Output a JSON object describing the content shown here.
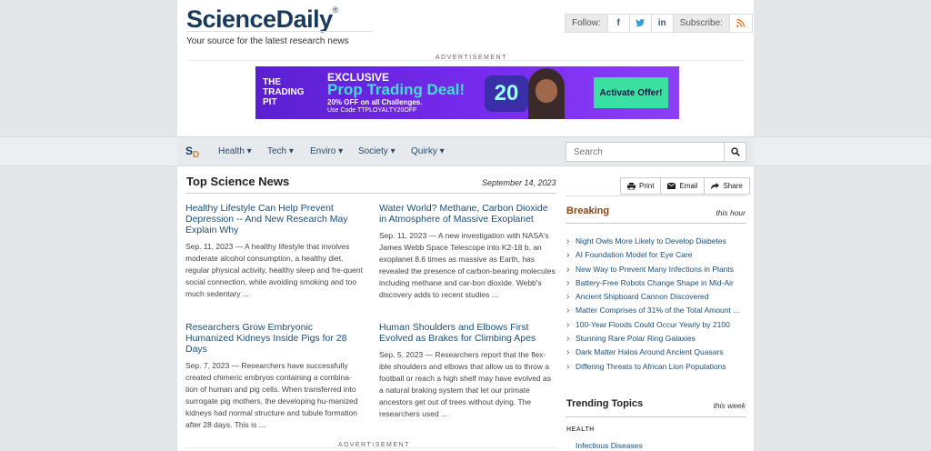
{
  "header": {
    "logo": "ScienceDaily",
    "logo_mark": "®",
    "tagline": "Your source for the latest research news",
    "follow_label": "Follow:",
    "subscribe_label": "Subscribe:"
  },
  "ads": {
    "label": "ADVERTISEMENT",
    "banner": {
      "brand": "THE TRADING PIT",
      "headline1": "EXCLUSIVE",
      "headline2": "Prop Trading Deal!",
      "offer": "20% OFF on all Challenges.",
      "code": "Use Code TTPLOYALTY20OFF",
      "graphic": "20",
      "cta": "Activate Offer!"
    }
  },
  "nav": {
    "logo_s": "S",
    "logo_d": "D",
    "items": [
      "Health ▾",
      "Tech ▾",
      "Enviro ▾",
      "Society ▾",
      "Quirky ▾"
    ],
    "search_placeholder": "Search"
  },
  "top_news": {
    "title": "Top Science News",
    "date": "September 14, 2023",
    "stories": [
      {
        "headline": "Healthy Lifestyle Can Help Prevent Depression -- And New Research May Explain Why",
        "summary": "Sep. 11, 2023 — A healthy lifestyle that involves moderate alcohol consumption, a healthy diet, regular physical activity, healthy sleep and fre-quent social connection, while avoiding smoking and too much sedentary ..."
      },
      {
        "headline": "Water World? Methane, Carbon Dioxide in Atmosphere of Massive Exoplanet",
        "summary": "Sep. 11, 2023 — A new investigation with NASA's James Webb Space Telescope into K2-18 b, an exoplanet 8.6 times as massive as Earth, has revealed the presence of carbon-bearing molecules including methane and car-bon dioxide. Webb's discovery adds to recent studies ..."
      },
      {
        "headline": "Researchers Grow Embryonic Humanized Kidneys Inside Pigs for 28 Days",
        "summary": "Sep. 7, 2023 — Researchers have successfully created chimeric embryos containing a combina-tion of human and pig cells. When transferred into surrogate pig mothers, the developing hu-manized kidneys had normal structure and tubule formation after 28 days. This is ..."
      },
      {
        "headline": "Human Shoulders and Elbows First Evolved as Brakes for Climbing Apes",
        "summary": "Sep. 5, 2023 — Researchers report that the flex-ible shoulders and elbows that allow us to throw a football or reach a high shelf may have evolved as a natural braking system that let our primate ancestors get out of trees without dying. The researchers used ..."
      }
    ]
  },
  "share": {
    "print": "Print",
    "email": "Email",
    "share": "Share"
  },
  "breaking": {
    "title": "Breaking",
    "subtitle": "this hour",
    "items": [
      "Night Owls More Likely to Develop Diabetes",
      "AI Foundation Model for Eye Care",
      "New Way to Prevent Many Infections in Plants",
      "Battery-Free Robots Change Shape in Mid-Air",
      "Ancient Shipboard Cannon Discovered",
      "Matter Comprises of 31% of the Total Amount ...",
      "100-Year Floods Could Occur Yearly by 2100",
      "Stunning Rare Polar Ring Galaxies",
      "Dark Matter Halos Around Ancient Quasars",
      "Differing Threats to African Lion Populations"
    ]
  },
  "trending": {
    "title": "Trending Topics",
    "subtitle": "this week",
    "category": "HEALTH",
    "first_item": "Infectious Diseases"
  },
  "colors": {
    "brand_navy": "#1a3a5c",
    "link": "#1a4f7a",
    "breaking": "#8b4513"
  }
}
